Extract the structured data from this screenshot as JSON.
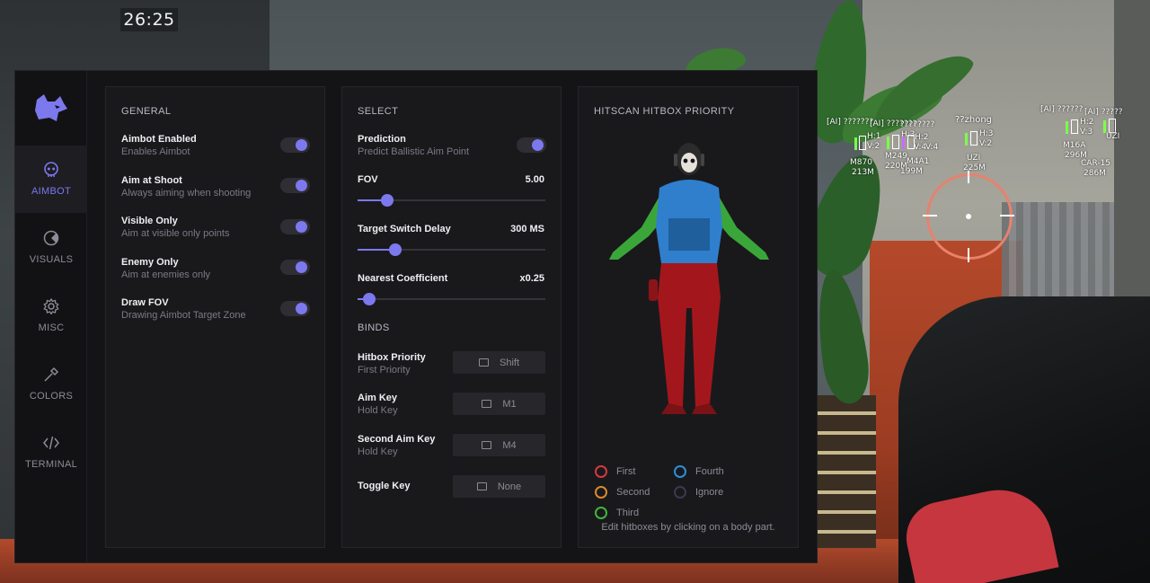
{
  "hud": {
    "timer": "26:25",
    "esp": [
      {
        "name": "[AI] ???????",
        "line2": "H:1",
        "line3": "V:2",
        "weapon": "M870",
        "distance": "213M"
      },
      {
        "name": "[AI] ???????",
        "line2": "H:3",
        "line3": "V:4",
        "weapon": "M249",
        "distance": "220M"
      },
      {
        "name": "????????",
        "line2": "H:2",
        "line3": "V:4",
        "weapon": "M4A1",
        "distance": "199M"
      },
      {
        "name": "??zhong",
        "line2": "H:3",
        "line3": "V:2",
        "weapon": "UZI",
        "distance": "225M"
      },
      {
        "name": "[AI] ??????",
        "line2": "H:2",
        "line3": "V:3",
        "weapon": "M16A",
        "distance": "296M"
      },
      {
        "name": "[AI] ?????",
        "line2": "UZI",
        "line3": "",
        "weapon": "CAR-15",
        "distance": "286M"
      }
    ]
  },
  "sidebar": {
    "items": [
      {
        "label": "AIMBOT",
        "icon": "skull-icon",
        "active": true
      },
      {
        "label": "VISUALS",
        "icon": "eye-circle-icon",
        "active": false
      },
      {
        "label": "MISC",
        "icon": "gear-icon",
        "active": false
      },
      {
        "label": "COLORS",
        "icon": "eyedropper-icon",
        "active": false
      },
      {
        "label": "TERMINAL",
        "icon": "code-icon",
        "active": false
      }
    ]
  },
  "general": {
    "title": "GENERAL",
    "options": [
      {
        "title": "Aimbot Enabled",
        "desc": "Enables Aimbot",
        "on": true
      },
      {
        "title": "Aim at Shoot",
        "desc": "Always aiming when shooting",
        "on": true
      },
      {
        "title": "Visible Only",
        "desc": "Aim at visible only points",
        "on": true
      },
      {
        "title": "Enemy Only",
        "desc": "Aim at enemies only",
        "on": true
      },
      {
        "title": "Draw FOV",
        "desc": "Drawing Aimbot Target Zone",
        "on": true
      }
    ]
  },
  "select": {
    "title": "SELECT",
    "prediction": {
      "title": "Prediction",
      "desc": "Predict Ballistic Aim Point",
      "on": true
    },
    "sliders": [
      {
        "label": "FOV",
        "value": "5.00",
        "fraction": 0.16
      },
      {
        "label": "Target Switch Delay",
        "value": "300 MS",
        "fraction": 0.2
      },
      {
        "label": "Nearest Coefficient",
        "value": "x0.25",
        "fraction": 0.06
      }
    ],
    "binds_title": "BINDS",
    "binds": [
      {
        "title": "Hitbox Priority",
        "desc": "First Priority",
        "key": "Shift"
      },
      {
        "title": "Aim Key",
        "desc": "Hold Key",
        "key": "M1"
      },
      {
        "title": "Second Aim Key",
        "desc": "Hold Key",
        "key": "M4"
      },
      {
        "title": "Toggle Key",
        "desc": "",
        "key": "None"
      }
    ]
  },
  "hitbox": {
    "title": "HITSCAN HITBOX PRIORITY",
    "legend": [
      {
        "label": "First",
        "color": "#d23a3e"
      },
      {
        "label": "Second",
        "color": "#d98a2c"
      },
      {
        "label": "Third",
        "color": "#43b43a"
      },
      {
        "label": "Fourth",
        "color": "#2e8fd8"
      },
      {
        "label": "Ignore",
        "color": "#3a3a50"
      }
    ],
    "hint": "Edit hitboxes by clicking on a body part."
  },
  "colors": {
    "accent": "#7c78ee",
    "panel": "#19191c",
    "background": "#141416"
  }
}
